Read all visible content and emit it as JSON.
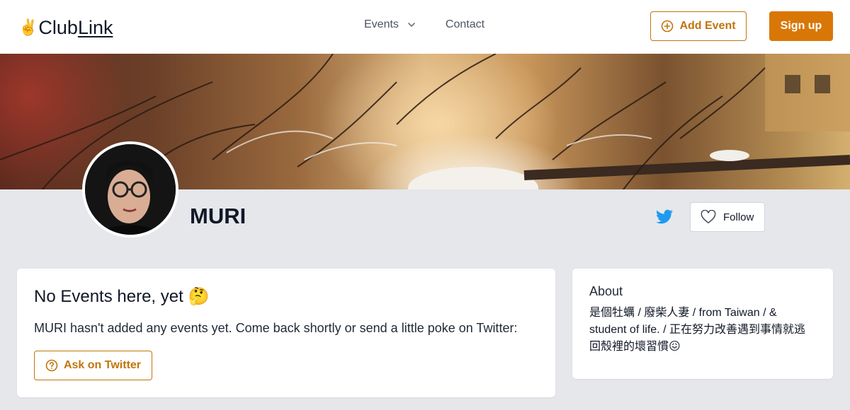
{
  "brand": {
    "logo_emoji": "✌️",
    "logo_part1": "Club",
    "logo_part2": "Link"
  },
  "nav": {
    "events_label": "Events",
    "contact_label": "Contact"
  },
  "header": {
    "add_event_label": "Add Event",
    "signup_label": "Sign up"
  },
  "profile": {
    "name": "MURI",
    "follow_label": "Follow"
  },
  "events_card": {
    "title": "No Events here, yet 🤔",
    "message": "MURI hasn't added any events yet. Come back shortly or send a little poke on Twitter:",
    "ask_label": "Ask on Twitter"
  },
  "about_card": {
    "title": "About",
    "text": "是個牡蠣 / 廢柴人妻 / from Taiwan / & student of life. / 正在努力改善遇到事情就逃回殼裡的壞習慣😖"
  },
  "colors": {
    "accent": "#d97706",
    "accent_text": "#c2740c",
    "twitter": "#1d9bf0",
    "page_bg": "#e5e7eb"
  }
}
